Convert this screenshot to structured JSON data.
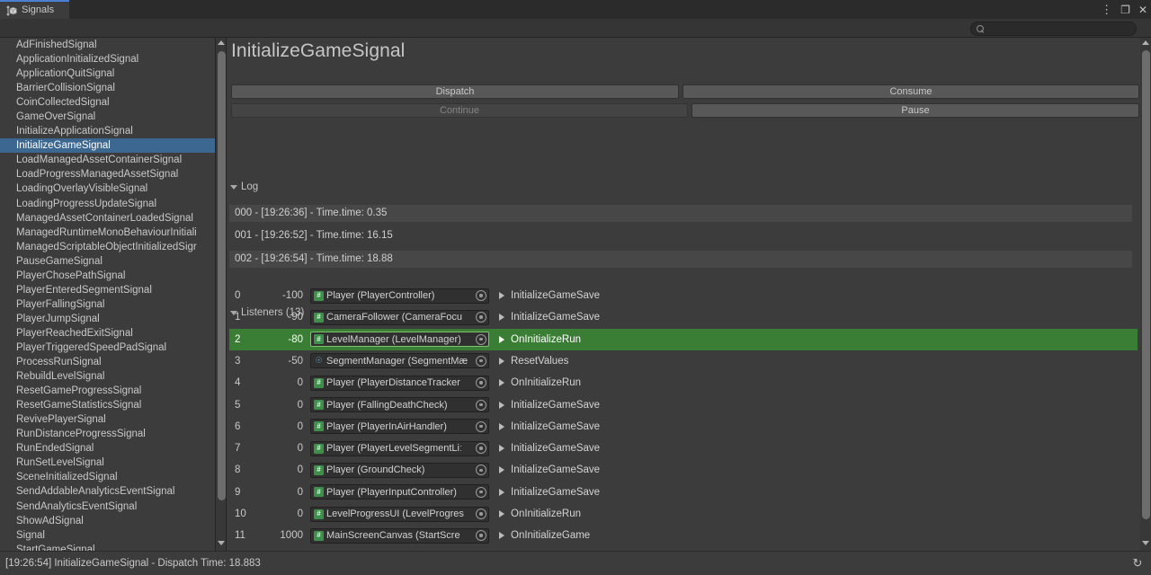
{
  "window": {
    "tab_label": "Signals",
    "tab_icon": "signal-cube-icon",
    "kebab_label": "⋮",
    "maximize_label": "❐",
    "close_label": "✕"
  },
  "search": {
    "placeholder": "",
    "value": "",
    "icon": "search-icon"
  },
  "signal_list": {
    "selected": "InitializeGameSignal",
    "items": [
      "AdFinishedSignal",
      "ApplicationInitializedSignal",
      "ApplicationQuitSignal",
      "BarrierCollisionSignal",
      "CoinCollectedSignal",
      "GameOverSignal",
      "InitializeApplicationSignal",
      "InitializeGameSignal",
      "LoadManagedAssetContainerSignal",
      "LoadProgressManagedAssetSignal",
      "LoadingOverlayVisibleSignal",
      "LoadingProgressUpdateSignal",
      "ManagedAssetContainerLoadedSignal",
      "ManagedRuntimeMonoBehaviourInitiali",
      "ManagedScriptableObjectInitializedSigr",
      "PauseGameSignal",
      "PlayerChosePathSignal",
      "PlayerEnteredSegmentSignal",
      "PlayerFallingSignal",
      "PlayerJumpSignal",
      "PlayerReachedExitSignal",
      "PlayerTriggeredSpeedPadSignal",
      "ProcessRunSignal",
      "RebuildLevelSignal",
      "ResetGameProgressSignal",
      "ResetGameStatisticsSignal",
      "RevivePlayerSignal",
      "RunDistanceProgressSignal",
      "RunEndedSignal",
      "RunSetLevelSignal",
      "SceneInitializedSignal",
      "SendAddableAnalyticsEventSignal",
      "SendAnalyticsEventSignal",
      "ShowAdSignal",
      "Signal",
      "StartGameSignal"
    ]
  },
  "detail": {
    "title": "InitializeGameSignal",
    "buttons": {
      "dispatch": "Dispatch",
      "consume": "Consume",
      "continue": "Continue",
      "pause": "Pause"
    },
    "log": {
      "header": "Log",
      "entries": [
        "000 - [19:26:36] - Time.time: 0.35",
        "001 - [19:26:52] - Time.time: 16.15",
        "002 - [19:26:54] - Time.time: 18.88"
      ]
    },
    "listeners": {
      "header": "Listeners (13)",
      "count": 13,
      "rows": [
        {
          "index": "0",
          "priority": "-100",
          "object": "Player (PlayerController)",
          "icon": "cs-script-icon",
          "method": "InitializeGameSave",
          "highlighted": false
        },
        {
          "index": "1",
          "priority": "-90",
          "object": "CameraFollower (CameraFocu",
          "icon": "cs-script-icon",
          "method": "InitializeGameSave",
          "highlighted": false
        },
        {
          "index": "2",
          "priority": "-80",
          "object": "LevelManager (LevelManager)",
          "icon": "cs-script-icon",
          "method": "OnInitializeRun",
          "highlighted": true
        },
        {
          "index": "3",
          "priority": "-50",
          "object": "SegmentManager (SegmentMæ",
          "icon": "prefab-icon",
          "method": "ResetValues",
          "highlighted": false
        },
        {
          "index": "4",
          "priority": "0",
          "object": "Player (PlayerDistanceTracker",
          "icon": "cs-script-icon",
          "method": "OnInitializeRun",
          "highlighted": false
        },
        {
          "index": "5",
          "priority": "0",
          "object": "Player (FallingDeathCheck)",
          "icon": "cs-script-icon",
          "method": "InitializeGameSave",
          "highlighted": false
        },
        {
          "index": "6",
          "priority": "0",
          "object": "Player (PlayerInAirHandler)",
          "icon": "cs-script-icon",
          "method": "InitializeGameSave",
          "highlighted": false
        },
        {
          "index": "7",
          "priority": "0",
          "object": "Player (PlayerLevelSegmentLiː",
          "icon": "cs-script-icon",
          "method": "InitializeGameSave",
          "highlighted": false
        },
        {
          "index": "8",
          "priority": "0",
          "object": "Player (GroundCheck)",
          "icon": "cs-script-icon",
          "method": "InitializeGameSave",
          "highlighted": false
        },
        {
          "index": "9",
          "priority": "0",
          "object": "Player (PlayerInputController)",
          "icon": "cs-script-icon",
          "method": "InitializeGameSave",
          "highlighted": false
        },
        {
          "index": "10",
          "priority": "0",
          "object": "LevelProgressUI (LevelProgres",
          "icon": "cs-script-icon",
          "method": "OnInitializeRun",
          "highlighted": false
        },
        {
          "index": "11",
          "priority": "1000",
          "object": "MainScreenCanvas (StartScre",
          "icon": "cs-script-icon",
          "method": "OnInitializeGame",
          "highlighted": false
        }
      ]
    }
  },
  "statusbar": {
    "text": "[19:26:54] InitializeGameSignal - Dispatch Time: 18.883",
    "refresh_icon": "↻"
  },
  "colors": {
    "selection_blue": "#3c6790",
    "listener_highlight_green": "#3a7d34",
    "panel_bg": "#3c3c3c",
    "titlebar_bg": "#2b2b2b",
    "tab_accent": "#4b7fd1",
    "script_icon_green": "#3f8f4c"
  }
}
